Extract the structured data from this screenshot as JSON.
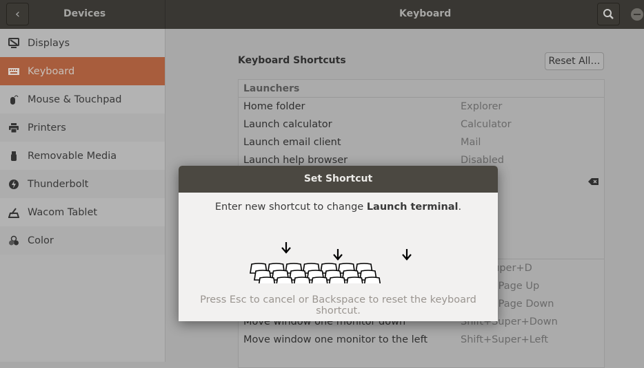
{
  "topbar": {
    "left_title": "Devices",
    "title": "Keyboard",
    "back_icon": "chevron-left-icon",
    "search_icon": "search-icon"
  },
  "sidebar": {
    "items": [
      {
        "label": "Displays",
        "icon": "display-icon"
      },
      {
        "label": "Keyboard",
        "icon": "keyboard-icon",
        "selected": true
      },
      {
        "label": "Mouse & Touchpad",
        "icon": "mouse-icon"
      },
      {
        "label": "Printers",
        "icon": "printer-icon"
      },
      {
        "label": "Removable Media",
        "icon": "usb-icon"
      },
      {
        "label": "Thunderbolt",
        "icon": "thunderbolt-icon"
      },
      {
        "label": "Wacom Tablet",
        "icon": "tablet-icon"
      },
      {
        "label": "Color",
        "icon": "color-icon"
      }
    ]
  },
  "main": {
    "title": "Keyboard Shortcuts",
    "reset_label": "Reset All…",
    "section": "Launchers",
    "rows": [
      {
        "name": "Home folder",
        "value": "Explorer"
      },
      {
        "name": "Launch calculator",
        "value": "Calculator"
      },
      {
        "name": "Launch email client",
        "value": "Mail"
      },
      {
        "name": "Launch help browser",
        "value": "Disabled"
      }
    ],
    "lower_rows": [
      {
        "name": "",
        "value": "Ctrl+Super+D"
      },
      {
        "name": "",
        "value": "Super+Page Up"
      },
      {
        "name": "",
        "value": "Super+Page Down"
      },
      {
        "name": "Move window one monitor down",
        "value": "Shift+Super+Down"
      },
      {
        "name": "Move window one monitor to the left",
        "value": "Shift+Super+Left"
      }
    ]
  },
  "dialog": {
    "title": "Set Shortcut",
    "message_prefix": "Enter new shortcut to change ",
    "message_target": "Launch terminal",
    "message_suffix": ".",
    "hint": "Press Esc to cancel or Backspace to reset the keyboard shortcut."
  },
  "colors": {
    "accent": "#a85d3d",
    "header": "#393733"
  }
}
